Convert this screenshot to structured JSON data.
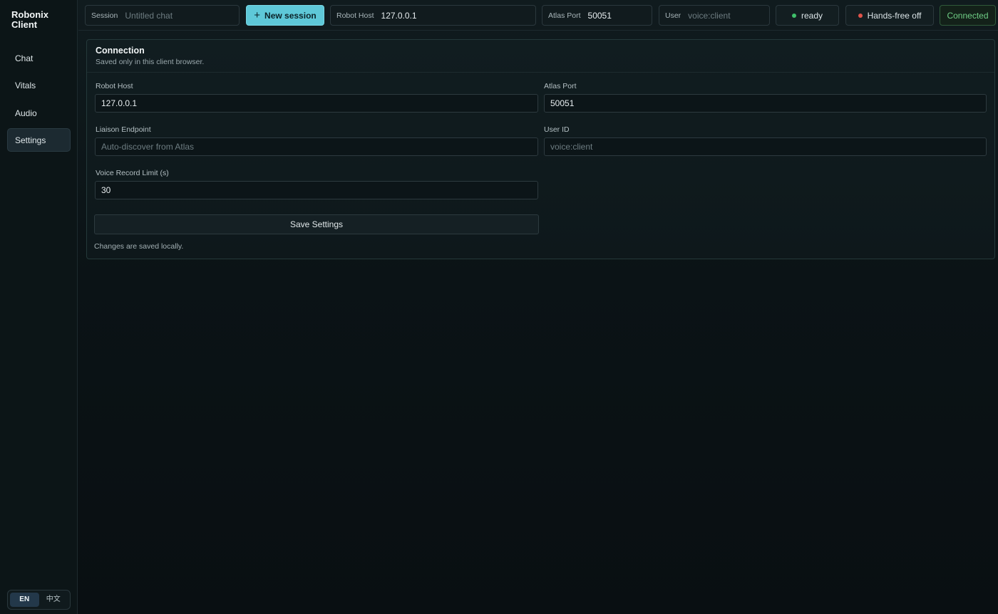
{
  "sidebar": {
    "brand": "Robonix\nClient",
    "items": [
      {
        "label": "Chat"
      },
      {
        "label": "Vitals"
      },
      {
        "label": "Audio"
      },
      {
        "label": "Settings"
      }
    ],
    "active": "Settings",
    "lang": {
      "en": "EN",
      "zh": "中文",
      "active": "EN"
    }
  },
  "topbar": {
    "session": {
      "label": "Session",
      "placeholder": "Untitled chat"
    },
    "new_session": "New session",
    "robot_host": {
      "label": "Robot Host",
      "value": "127.0.0.1"
    },
    "atlas_port": {
      "label": "Atlas Port",
      "value": "50051"
    },
    "user": {
      "label": "User",
      "placeholder": "voice:client"
    },
    "status": {
      "label": "ready",
      "color": "#3fbf6a"
    },
    "hands_free": {
      "label": "Hands-free off",
      "color": "#e0534a"
    },
    "connection": "Connected"
  },
  "connection_card": {
    "title": "Connection",
    "subtitle": "Saved only in this client browser.",
    "robot_host": {
      "label": "Robot Host",
      "value": "127.0.0.1"
    },
    "atlas_port": {
      "label": "Atlas Port",
      "value": "50051"
    },
    "liaison_endpoint": {
      "label": "Liaison Endpoint",
      "placeholder": "Auto-discover from Atlas"
    },
    "user_id": {
      "label": "User ID",
      "placeholder": "voice:client"
    },
    "voice_limit": {
      "label": "Voice Record Limit (s)",
      "value": "30"
    },
    "save_label": "Save Settings",
    "note": "Changes are saved locally."
  },
  "colors": {
    "accent": "#5ec8d8",
    "connected": "#6fce86"
  }
}
